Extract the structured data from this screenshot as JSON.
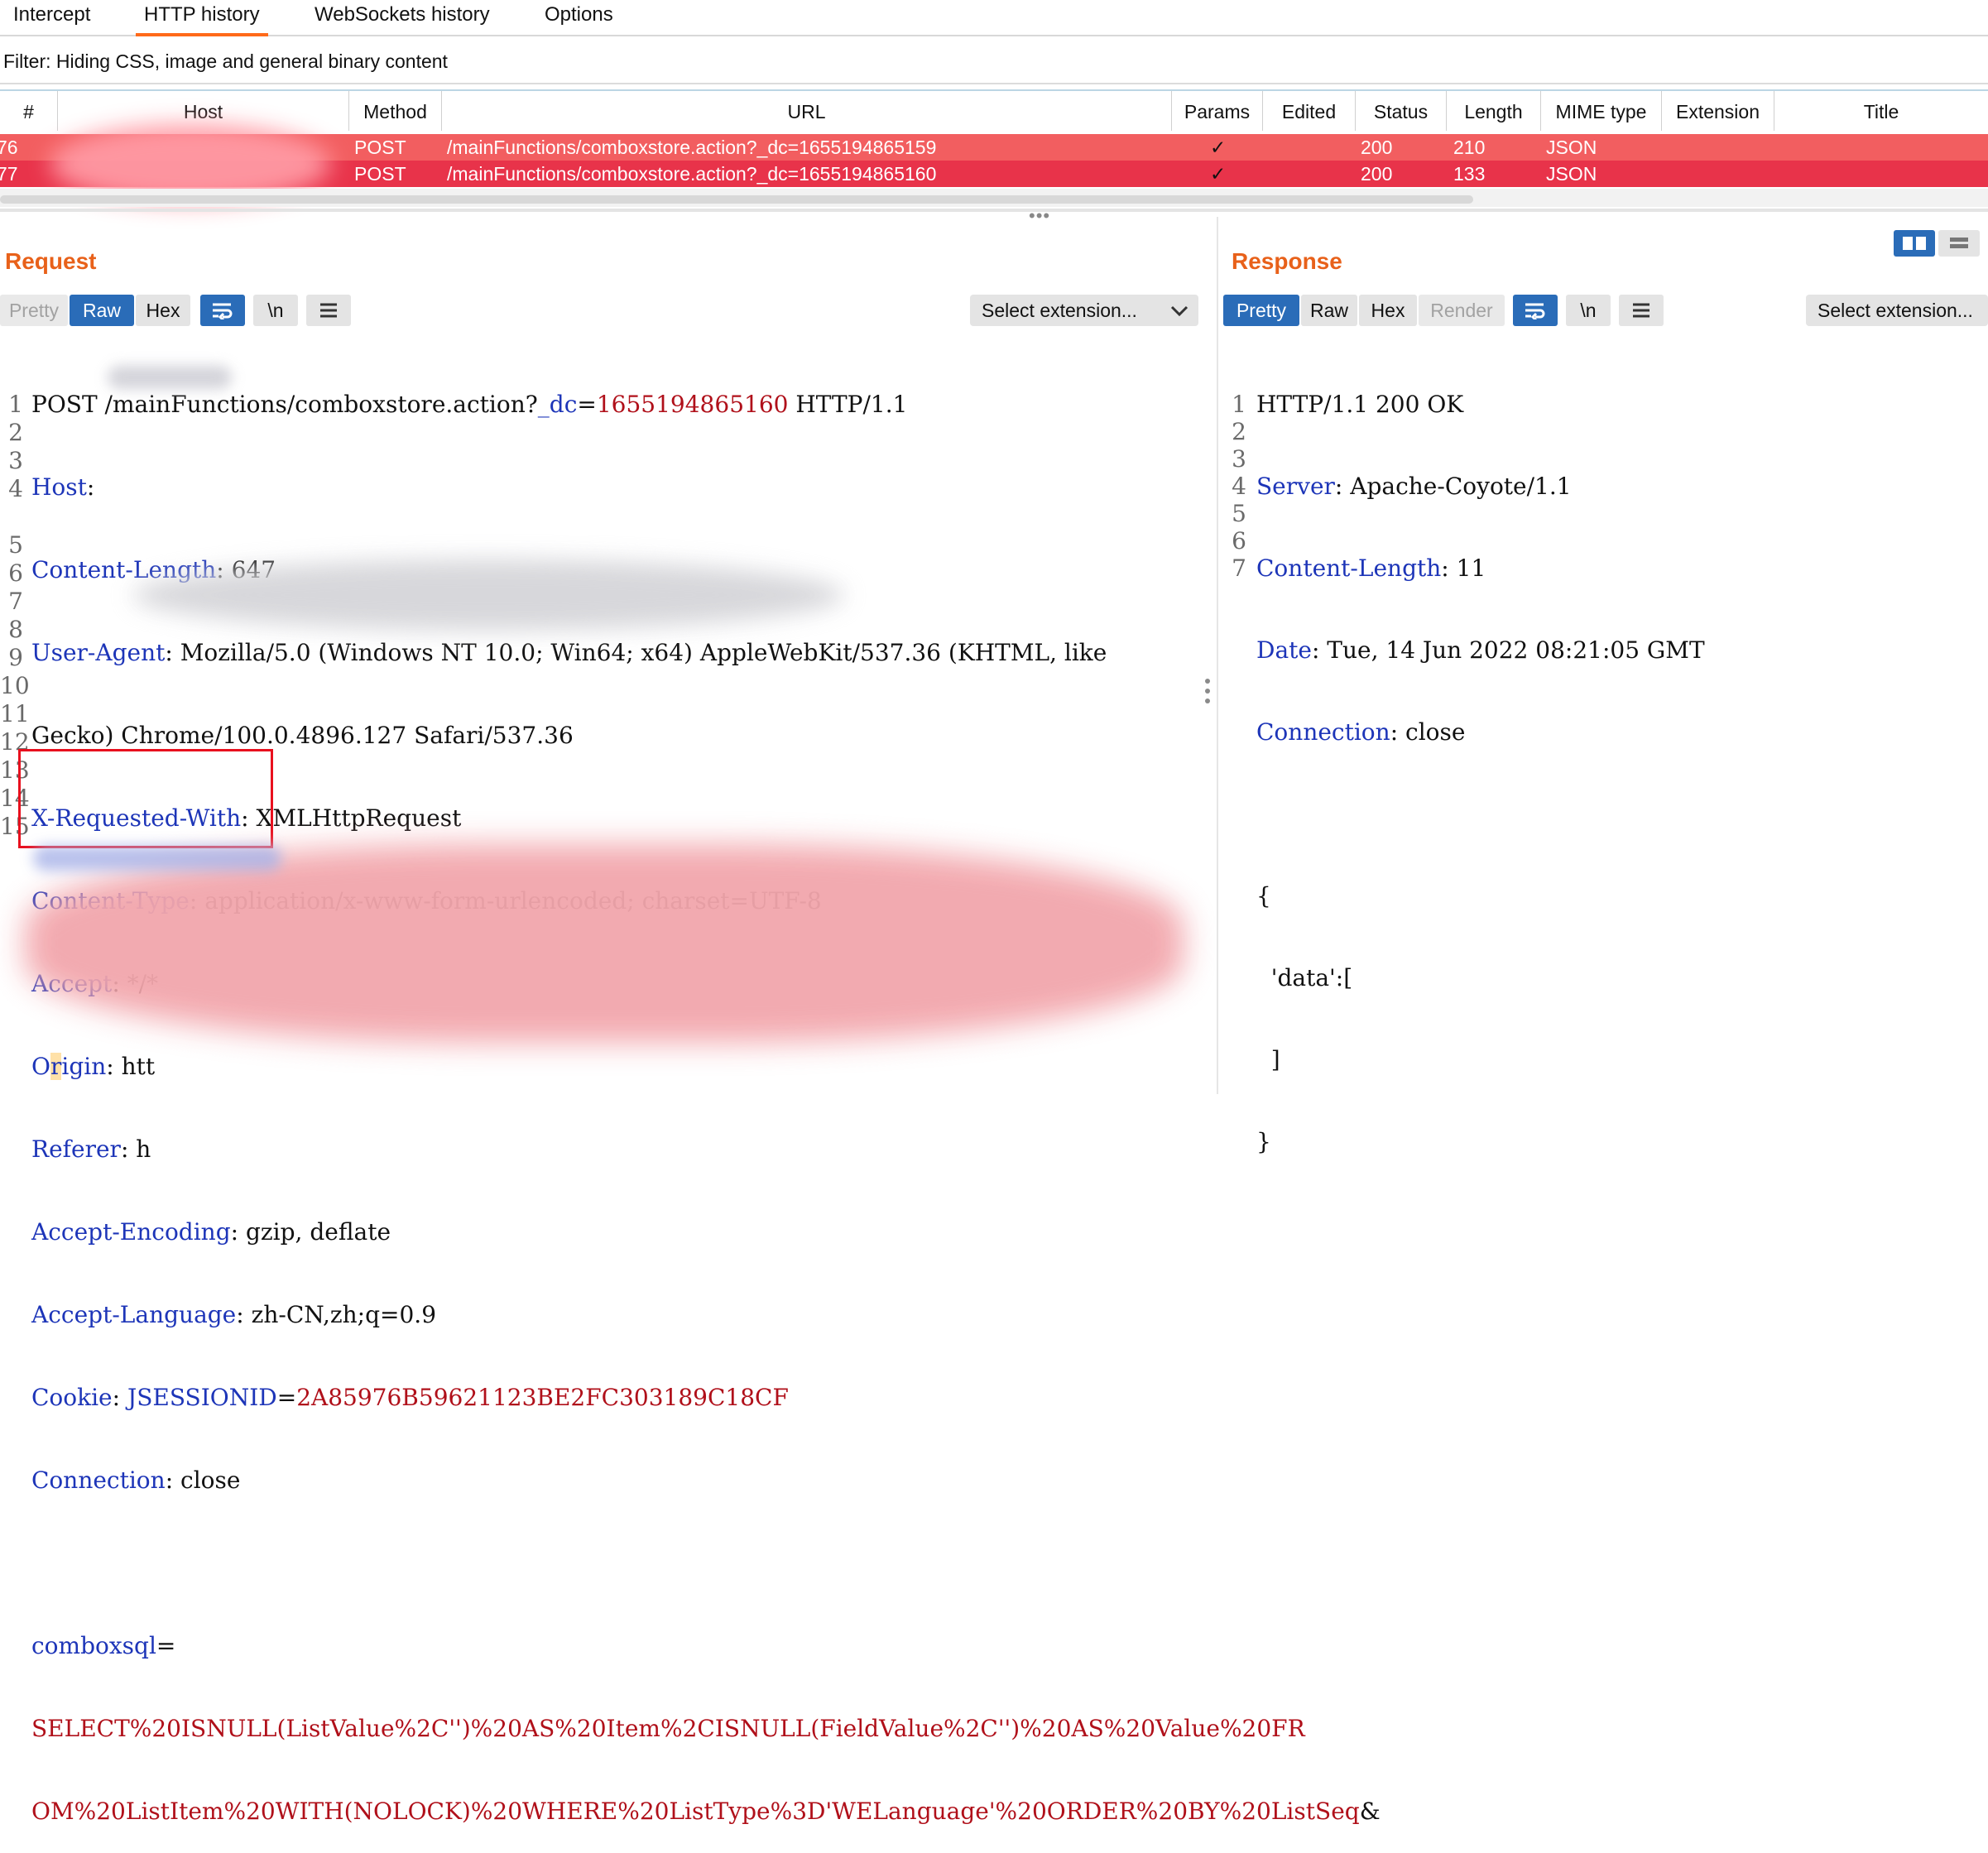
{
  "tabs": [
    "Intercept",
    "HTTP history",
    "WebSockets history",
    "Options"
  ],
  "filter": "Filter: Hiding CSS, image and general binary content",
  "history": {
    "columns": [
      "#",
      "Host",
      "Method",
      "URL",
      "Params",
      "Edited",
      "Status",
      "Length",
      "MIME type",
      "Extension",
      "Title"
    ],
    "rows": [
      {
        "num": "76",
        "method": "POST",
        "url": "/mainFunctions/comboxstore.action?_dc=1655194865159",
        "params": "✓",
        "status": "200",
        "length": "210",
        "mime": "JSON"
      },
      {
        "num": "77",
        "method": "POST",
        "url": "/mainFunctions/comboxstore.action?_dc=1655194865160",
        "params": "✓",
        "status": "200",
        "length": "133",
        "mime": "JSON"
      }
    ]
  },
  "request": {
    "title": "Request",
    "buttons": {
      "pretty": "Pretty",
      "raw": "Raw",
      "hex": "Hex",
      "newline": "\\n"
    },
    "select_ext": "Select extension...",
    "lines": {
      "l1_method": "POST /mainFunctions/comboxstore.action?",
      "l1_param": "_dc",
      "l1_eq": "=",
      "l1_val": "1655194865160",
      "l1_proto": " HTTP/1.1",
      "l2_k": "Host",
      "l3_k": "Content-Length",
      "l3_v": ": 647",
      "l4_k": "User-Agent",
      "l4_v": ": Mozilla/5.0 (Windows NT 10.0; Win64; x64) AppleWebKit/537.36 (KHTML, like",
      "l4b": "Gecko) Chrome/100.0.4896.127 Safari/537.36",
      "l5_k": "X-Requested-With",
      "l5_v": ": XMLHttpRequest",
      "l6_k": "Content-Type",
      "l6_v": ": application/x-www-form-urlencoded; charset=UTF-8",
      "l7_k": "Accept",
      "l7_v": ": */*",
      "l8_k1": "O",
      "l8_k2": "r",
      "l8_k3": "igin",
      "l8_v": ": htt",
      "l9_k": "Referer",
      "l9_v": ": h",
      "l10_k": "Accept-Encoding",
      "l10_v": ": gzip, deflate",
      "l11_k": "Accept-Language",
      "l11_v": ": zh-CN,zh;q=0.9",
      "l12_k": "Cookie",
      "l12_c": ": ",
      "l12_p": "JSESSIONID",
      "l12_eq": "=",
      "l12_v": "2A85976B59621123BE2FC303189C18CF",
      "l13_k": "Connection",
      "l13_v": ": close",
      "l15_k": "comboxsql",
      "l15_eq": "=",
      "l15b": "SELECT%20ISNULL(ListValue%2C'')%20AS%20Item%2CISNULL(FieldValue%2C'')%20AS%20Value%20FR",
      "l15c": "OM%20ListItem%20WITH(NOLOCK)%20WHERE%20ListType%3D'WELanguage'%20ORDER%20BY%20ListSeq",
      "l15c_amp": "&"
    }
  },
  "response": {
    "title": "Response",
    "buttons": {
      "pretty": "Pretty",
      "raw": "Raw",
      "hex": "Hex",
      "render": "Render",
      "newline": "\\n"
    },
    "select_ext": "Select extension...",
    "lines": {
      "l1": "HTTP/1.1 200 OK",
      "l2_k": "Server",
      "l2_v": ": Apache-Coyote/1.1",
      "l3_k": "Content-Length",
      "l3_v": ": 11",
      "l4_k": "Date",
      "l4_v": ": Tue, 14 Jun 2022 08:21:05 GMT",
      "l5_k": "Connection",
      "l5_v": ": close",
      "l7": "{",
      "l8": "  'data':[",
      "l9": "  ]",
      "l10": "}"
    }
  },
  "colors": {
    "accent": "#ff6a1a",
    "row_highlight_1": "#f25e60",
    "row_highlight_2": "#e8334a",
    "header_key": "#1d35b8",
    "value_red": "#b0101a",
    "active_button": "#2a6cb8"
  }
}
